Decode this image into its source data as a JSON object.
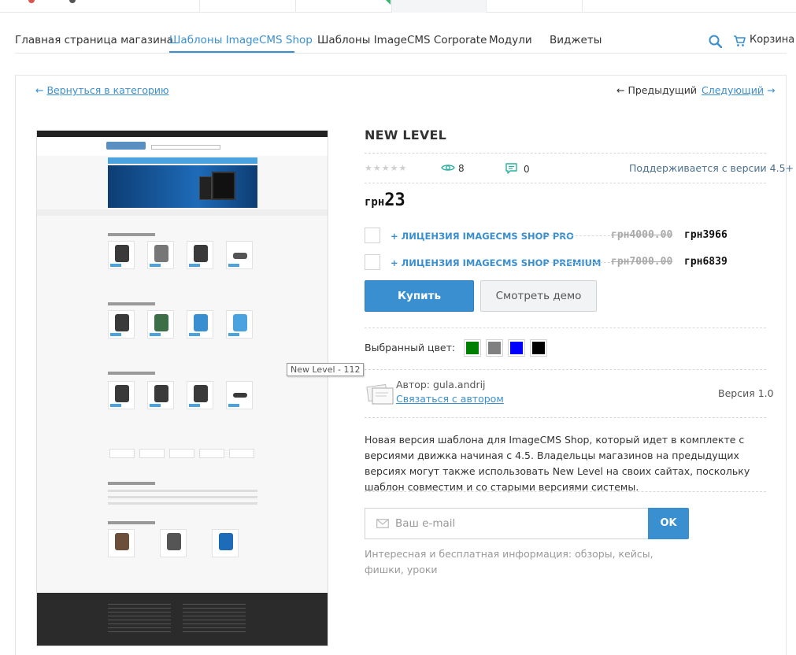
{
  "nav": {
    "items": [
      {
        "label": "Главная страница магазина"
      },
      {
        "label": "Шаблоны ImageCMS Shop"
      },
      {
        "label": "Шаблоны ImageCMS Corporate"
      },
      {
        "label": "Модули"
      },
      {
        "label": "Виджеты"
      }
    ],
    "cart_label": "Корзина"
  },
  "pager": {
    "back_arrow": "←",
    "back_label": "Вернуться в категорию",
    "prev_label": "← Предыдущий",
    "next_label": "Следующий",
    "next_arrow": "→"
  },
  "tooltip": "New Level - 112",
  "product": {
    "title": "NEW LEVEL",
    "stars": "★★★★★",
    "views": "8",
    "comments": "0",
    "supported": "Поддерживается с версии 4.5+",
    "price_currency": "грн",
    "price_value": "23"
  },
  "licenses": [
    {
      "name": "+ ЛИЦЕНЗИЯ IMAGECMS SHOP PRO",
      "old_price": "грн4000.00",
      "new_price": "грн3966"
    },
    {
      "name": "+ ЛИЦЕНЗИЯ IMAGECMS SHOP PREMIUM",
      "old_price": "грн7000.00",
      "new_price": "грн6839"
    }
  ],
  "buttons": {
    "buy": "Купить",
    "demo": "Смотреть демо"
  },
  "colors": {
    "label": "Выбранный цвет:",
    "swatches": [
      "#008000",
      "#808080",
      "#0000ff",
      "#000000"
    ]
  },
  "author": {
    "name": "Автор: gula.andrij",
    "contact": "Связаться с автором",
    "version": "Версия 1.0"
  },
  "description": "Новая версия шаблона для ImageCMS Shop, который идет в комплекте с версиями движка начиная с 4.5. Владельцы магазинов на предыдущих версиях могут также использовать New Level на своих сайтах, поскольку шаблон совместим и со старыми версиями системы.",
  "subscribe": {
    "placeholder": "Ваш e-mail",
    "button": "OK",
    "info": "Интересная и бесплатная информация: обзоры, кейсы, фишки, уроки"
  },
  "accent": "#3a8fd0"
}
